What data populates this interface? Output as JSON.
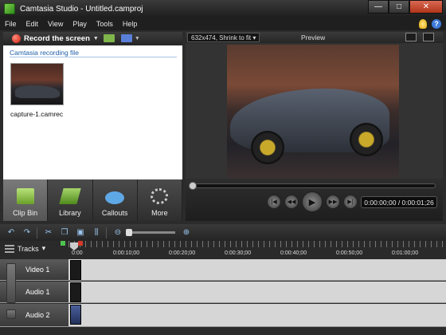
{
  "window": {
    "title": "Camtasia Studio - Untitled.camproj",
    "minimize_glyph": "—",
    "maximize_glyph": "□",
    "close_glyph": "✕"
  },
  "menu": {
    "items": [
      "File",
      "Edit",
      "View",
      "Play",
      "Tools",
      "Help"
    ]
  },
  "left_toolbar": {
    "record_label": "Record the screen",
    "dropdown_glyph": "▼"
  },
  "clip_bin": {
    "heading": "Camtasia recording file",
    "clips": [
      {
        "filename": "capture-1.camrec"
      }
    ]
  },
  "tabs": [
    {
      "label": "Clip Bin",
      "icon": "clip-bin-icon",
      "active": true
    },
    {
      "label": "Library",
      "icon": "library-icon",
      "active": false
    },
    {
      "label": "Callouts",
      "icon": "callouts-icon",
      "active": false
    },
    {
      "label": "More",
      "icon": "more-icon",
      "active": false
    }
  ],
  "preview": {
    "zoom_value": "632x474, Shrink to fit",
    "label": "Preview",
    "time_readout": "0:00:00;00 / 0:00:01;26"
  },
  "transport": {
    "prev_glyph": "|◀",
    "rewind_glyph": "◀◀",
    "play_glyph": "▶",
    "forward_glyph": "▶▶",
    "next_glyph": "▶|"
  },
  "timeline": {
    "tracks_label": "Tracks",
    "ruler_labels": [
      "0:00",
      "0:00:10;00",
      "0:00:20;00",
      "0:00:30;00",
      "0:00:40;00",
      "0:00:50;00",
      "0:01:00;00"
    ],
    "tracks": [
      {
        "label": "Video 1"
      },
      {
        "label": "Audio 1"
      },
      {
        "label": "Audio 2"
      }
    ]
  },
  "colors": {
    "accent": "#1e5ea8",
    "record": "#c91d0c",
    "track_bg": "#d6d6d6"
  }
}
